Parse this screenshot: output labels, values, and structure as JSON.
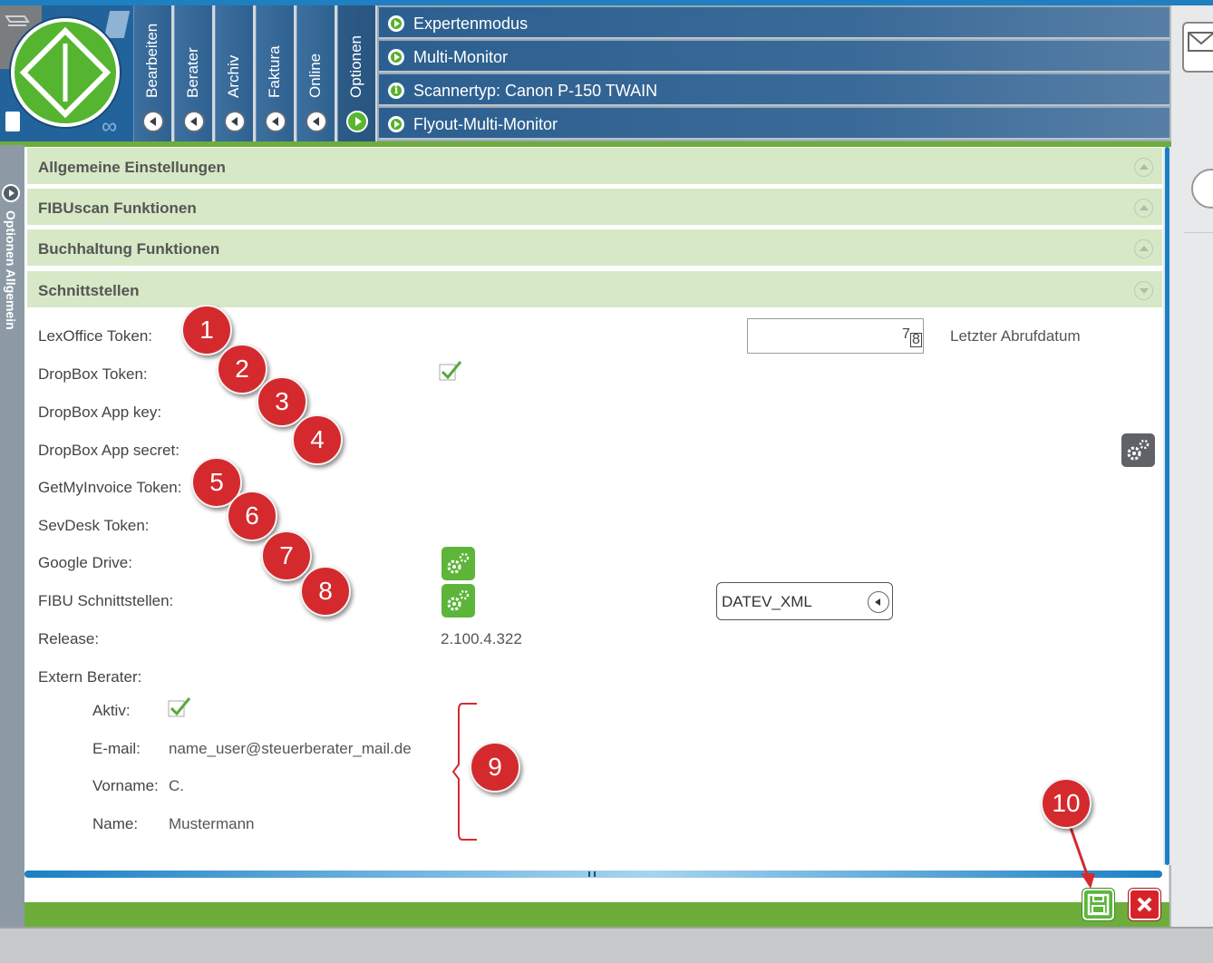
{
  "nav_tabs": [
    {
      "label": "Bearbeiten",
      "active": false
    },
    {
      "label": "Berater",
      "active": false
    },
    {
      "label": "Archiv",
      "active": false
    },
    {
      "label": "Faktura",
      "active": false
    },
    {
      "label": "Online",
      "active": false
    },
    {
      "label": "Optionen",
      "active": true
    }
  ],
  "options_menu": [
    {
      "label": "Expertenmodus",
      "icon": "play-icon"
    },
    {
      "label": "Multi-Monitor",
      "icon": "play-icon"
    },
    {
      "label": "Scannertyp: Canon P-150 TWAIN",
      "icon": "info-icon"
    },
    {
      "label": "Flyout-Multi-Monitor",
      "icon": "play-icon"
    }
  ],
  "side_panel": {
    "label": "Optionen   Allgemein"
  },
  "sections": [
    {
      "title": "Allgemeine Einstellungen",
      "expanded": false
    },
    {
      "title": "FIBUscan Funktionen",
      "expanded": false
    },
    {
      "title": "Buchhaltung Funktionen",
      "expanded": false
    },
    {
      "title": "Schnittstellen",
      "expanded": true
    }
  ],
  "fields": {
    "lexoffice_token": "LexOffice Token:",
    "dropbox_token": "DropBox Token:",
    "dropbox_app_key": "DropBox App key:",
    "dropbox_app_secret": "DropBox App secret:",
    "getmyinvoice_token": "GetMyInvoice Token:",
    "sevdesk_token": "SevDesk Token:",
    "google_drive": "Google Drive:",
    "fibu_schnittstellen": "FIBU Schnittstellen:",
    "release": "Release:",
    "extern_berater": "Extern Berater:"
  },
  "last_fetch": {
    "label": "Letzter Abrufdatum",
    "cal_day_top": "7",
    "cal_day_bottom": "8"
  },
  "fibu_select": {
    "value": "DATEV_XML"
  },
  "release_value": "2.100.4.322",
  "extern": {
    "aktiv_label": "Aktiv:",
    "email_label": "E-mail:",
    "email_value": "name_user@steuerberater_mail.de",
    "vorname_label": "Vorname:",
    "vorname_value": "C.",
    "name_label": "Name:",
    "name_value": "Mustermann"
  },
  "markers": [
    "1",
    "2",
    "3",
    "4",
    "5",
    "6",
    "7",
    "8",
    "9",
    "10"
  ],
  "colors": {
    "brand_blue": "#2f6190",
    "accent_green": "#6dae3a",
    "section_green": "#d7e8c6",
    "marker_red": "#d42a2e",
    "close_red": "#d6232a"
  }
}
